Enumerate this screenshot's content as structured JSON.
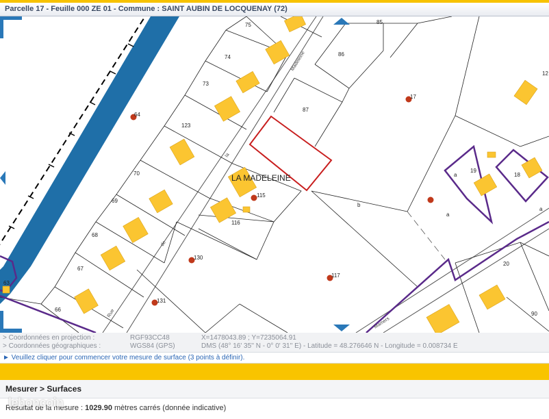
{
  "title": "Parcelle 17 - Feuille 000 ZE 01 - Commune : SAINT AUBIN DE LOCQUENAY (72)",
  "map": {
    "place_label": "LA MADELEINE",
    "street_words": [
      "Rue",
      "de",
      "la",
      "Madeleine"
    ],
    "street_lower": "Mamers",
    "parcels": [
      "75",
      "85",
      "74",
      "86",
      "73",
      "87",
      "17",
      "123",
      "64",
      "70",
      "19",
      "18",
      "12",
      "69",
      "115",
      "116",
      "68",
      "67",
      "130",
      "117",
      "20",
      "63",
      "66",
      "131",
      "90"
    ],
    "sub_labels": [
      "a",
      "b",
      "a",
      "a",
      "a"
    ]
  },
  "coords": {
    "projection_label": "> Coordonnées en projection :",
    "projection_system": "RGF93CC48",
    "projection_value": "X=1478043.89 ; Y=7235064.91",
    "geo_label": "> Coordonnées géographiques :",
    "geo_system": "WGS84 (GPS)",
    "geo_value": "DMS (48° 16' 35'' N - 0° 0' 31'' E) - Latitude = 48.276646 N - Longitude = 0.008734 E"
  },
  "instruction": "► Veuillez cliquer pour commencer votre mesure de surface (3 points à définir).",
  "panel": {
    "title": "Mesurer > Surfaces",
    "result_prefix": "Résultat de la mesure : ",
    "result_value": "1029.90",
    "result_suffix": " mètres carrés (donnée indicative)"
  },
  "watermark": "leboncoin",
  "colors": {
    "accent_yellow": "#f9c400",
    "building": "#fbc531",
    "river": "#1f6fa8",
    "commune_boundary": "#5a2a8a",
    "selected_parcel": "#c81e1e",
    "marker": "#c0391b",
    "nav_arrow": "#2a78b8"
  }
}
